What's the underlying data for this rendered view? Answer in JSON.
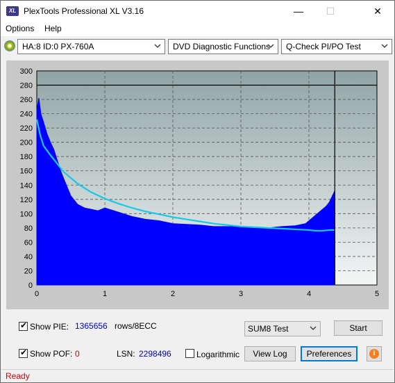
{
  "window": {
    "title": "PlexTools Professional XL V3.16",
    "app_icon_text": "XL",
    "minimize": "—",
    "maximize": "☐",
    "close": "✕"
  },
  "menu": {
    "items": [
      "Options",
      "Help"
    ]
  },
  "toolbar": {
    "drive": "HA:8 ID:0  PX-760A",
    "function": "DVD Diagnostic Functions",
    "test": "Q-Check PI/PO Test"
  },
  "chart_data": {
    "type": "area",
    "title": "",
    "xlabel": "",
    "ylabel": "",
    "xlim": [
      0,
      5
    ],
    "ylim": [
      0,
      300
    ],
    "x_ticks": [
      "0",
      "1",
      "2",
      "3",
      "4",
      "5"
    ],
    "y_ticks": [
      "0",
      "20",
      "40",
      "60",
      "80",
      "100",
      "120",
      "140",
      "160",
      "180",
      "200",
      "220",
      "240",
      "260",
      "280",
      "300"
    ],
    "limit_line": 280,
    "end_marker_x": 4.38,
    "colors": {
      "pie": "#0000ff",
      "average": "#18c8e8",
      "limit": "#000000",
      "background_top": "#90a4a4",
      "background_bottom": "#f4f6f6"
    },
    "series": [
      {
        "name": "PIE",
        "x": [
          0,
          0.03,
          0.06,
          0.1,
          0.15,
          0.2,
          0.25,
          0.3,
          0.35,
          0.4,
          0.5,
          0.6,
          0.7,
          0.8,
          0.9,
          1.0,
          1.2,
          1.4,
          1.6,
          1.8,
          2.0,
          2.2,
          2.4,
          2.6,
          2.8,
          3.0,
          3.2,
          3.4,
          3.6,
          3.8,
          3.95,
          4.0,
          4.1,
          4.2,
          4.25,
          4.3,
          4.33,
          4.36,
          4.38
        ],
        "y": [
          245,
          262,
          240,
          228,
          212,
          200,
          190,
          175,
          160,
          148,
          125,
          113,
          108,
          106,
          104,
          108,
          102,
          96,
          92,
          90,
          86,
          85,
          84,
          82,
          82,
          82,
          80,
          80,
          82,
          83,
          86,
          90,
          98,
          106,
          110,
          116,
          122,
          128,
          132
        ]
      },
      {
        "name": "Average",
        "x": [
          0,
          0.05,
          0.1,
          0.2,
          0.3,
          0.4,
          0.5,
          0.6,
          0.8,
          1.0,
          1.2,
          1.4,
          1.6,
          1.8,
          2.0,
          2.2,
          2.4,
          2.6,
          2.8,
          3.0,
          3.2,
          3.4,
          3.6,
          3.8,
          4.0,
          4.1,
          4.2,
          4.3,
          4.38
        ],
        "y": [
          232,
          210,
          195,
          182,
          170,
          158,
          150,
          142,
          130,
          121,
          114,
          108,
          103,
          99,
          95,
          92,
          89,
          86,
          84,
          82,
          81,
          80,
          79,
          78,
          77,
          76,
          76,
          77,
          77
        ]
      }
    ]
  },
  "bottom": {
    "show_pie_label": "Show PIE:",
    "pie_value": "1365656",
    "pie_units": "rows/8ECC",
    "show_pof_label": "Show POF:",
    "pof_value": "0",
    "lsn_label": "LSN:",
    "lsn_value": "2298496",
    "logarithmic_label": "Logarithmic",
    "sum_select": "SUM8 Test",
    "start_button": "Start",
    "view_log_button": "View Log",
    "preferences_button": "Preferences",
    "info_icon": "i"
  },
  "status": {
    "text": "Ready"
  }
}
